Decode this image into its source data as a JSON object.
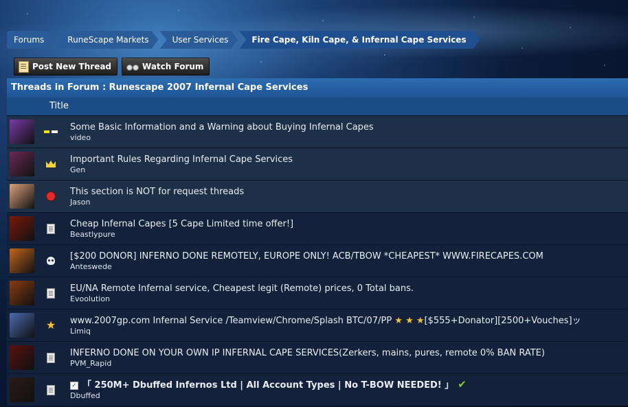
{
  "breadcrumb": [
    "Forums",
    "RuneScape Markets",
    "User Services",
    "Fire Cape, Kiln Cape, & Infernal Cape Services"
  ],
  "actions": {
    "post": "Post New Thread",
    "watch": "Watch Forum"
  },
  "forum": {
    "header": "Threads in Forum : Runescape 2007 Infernal Cape Services",
    "column_title": "Title"
  },
  "threads": [
    {
      "title": "Some Basic Information and a Warning about Buying Infernal Capes",
      "author": "video",
      "sticky": true,
      "icon": "video-icon",
      "avatar_color": "#7a3aa8"
    },
    {
      "title": "Important Rules Regarding Infernal Cape Services",
      "author": "Gen",
      "sticky": true,
      "icon": "crown-icon",
      "avatar_color": "#6b2a55"
    },
    {
      "title": "This section is NOT for request threads",
      "author": "Jason",
      "sticky": true,
      "icon": "ribbon-icon",
      "avatar_color": "#d9a07a"
    },
    {
      "title": "Cheap Infernal Capes [5 Cape Limited time offer!]",
      "author": "Beastlypure",
      "sticky": false,
      "icon": "document-icon",
      "avatar_color": "#7a1a0a"
    },
    {
      "title": "[$200 DONOR] INFERNO DONE REMOTELY, EUROPE ONLY! ACB/TBOW *CHEAPEST* WWW.FIRECAPES.COM",
      "author": "Anteswede",
      "sticky": false,
      "icon": "skull-icon",
      "avatar_color": "#c2661a"
    },
    {
      "title": "EU/NA Remote Infernal service, Cheapest legit (Remote) prices, 0 Total bans.",
      "author": "Evoolution",
      "sticky": false,
      "icon": "document-icon",
      "avatar_color": "#8a3a10"
    },
    {
      "title": "www.2007gp.com Infernal Service /Teamview/Chrome/Splash BTC/07/PP",
      "title_stars": "★ ★ ★",
      "title_suffix": "[$555+Donator][2500+Vouches]ッ",
      "author": "Limiq",
      "sticky": false,
      "icon": "star-icon",
      "avatar_color": "#4a6ab0"
    },
    {
      "title": "INFERNO DONE ON YOUR OWN IP INFERNAL CAPE SERVICES(Zerkers, mains, pures, remote 0% BAN RATE)",
      "author": "PVM_Rapid",
      "sticky": false,
      "icon": "document-icon",
      "avatar_color": "#5a1010"
    },
    {
      "title": "「 250M+ Dbuffed Infernos Ltd | All Account Types | No T-BOW NEEDED! 」",
      "author": "Dbuffed",
      "sticky": false,
      "icon": "document-icon",
      "avatar_color": "#2a1a14",
      "bold": true,
      "checkmark": "✔"
    }
  ]
}
